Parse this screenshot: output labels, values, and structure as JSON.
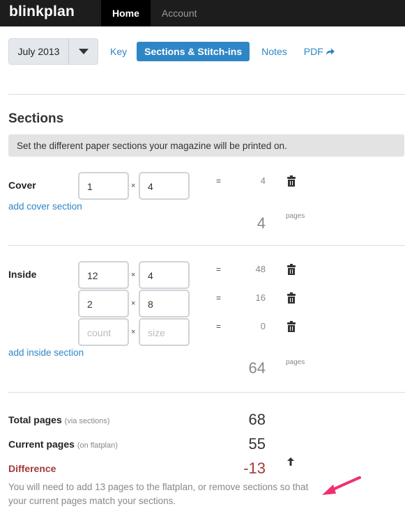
{
  "nav": {
    "brand": "blinkplan",
    "items": [
      {
        "label": "Home",
        "active": true
      },
      {
        "label": "Account",
        "active": false
      }
    ]
  },
  "toolbar": {
    "month": "July 2013",
    "tabs": {
      "key": "Key",
      "sections": "Sections & Stitch-ins",
      "notes": "Notes",
      "pdf": "PDF"
    }
  },
  "sections": {
    "title": "Sections",
    "hint": "Set the different paper sections your magazine will be printed on.",
    "times_symbol": "×",
    "equals_symbol": "=",
    "pages_label": "pages",
    "cover": {
      "label": "Cover",
      "add_link": "add cover section",
      "rows": [
        {
          "count": "1",
          "size": "4",
          "result": "4"
        }
      ],
      "total": "4"
    },
    "inside": {
      "label": "Inside",
      "add_link": "add inside section",
      "rows": [
        {
          "count": "12",
          "size": "4",
          "result": "48"
        },
        {
          "count": "2",
          "size": "8",
          "result": "16"
        },
        {
          "count": "",
          "size": "",
          "result": "0",
          "count_placeholder": "count",
          "size_placeholder": "size"
        }
      ],
      "total": "64"
    }
  },
  "summary": {
    "total_pages": {
      "label": "Total pages",
      "note": "(via sections)",
      "value": "68"
    },
    "current_pages": {
      "label": "Current pages",
      "note": "(on flatplan)",
      "value": "55"
    },
    "difference": {
      "label": "Difference",
      "value": "-13"
    },
    "message": "You will need to add 13 pages to the flatplan, or remove sections so that your current pages match your sections."
  },
  "colors": {
    "accent": "#2f86c6",
    "danger": "#a33a3a",
    "topbar": "#1d1d1d",
    "annotation_arrow": "#f0306e"
  },
  "icons": [
    "caret-down-icon",
    "share-arrow-icon",
    "trash-icon",
    "up-arrow-icon",
    "annotation-arrow-icon"
  ]
}
